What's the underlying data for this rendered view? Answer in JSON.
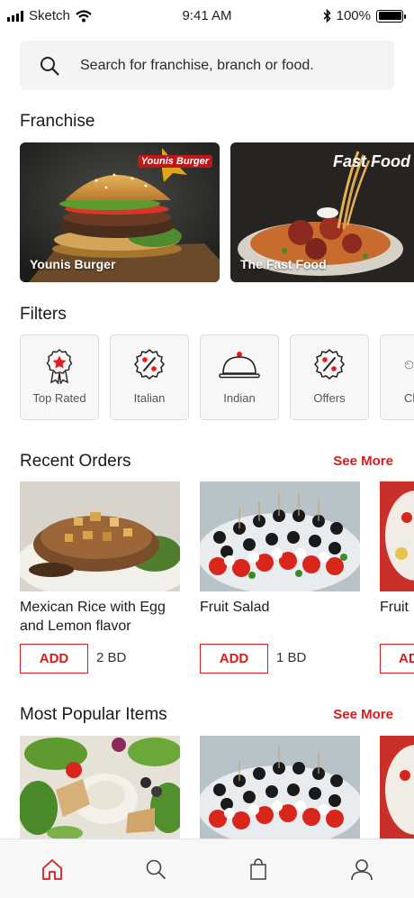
{
  "status_bar": {
    "carrier": "Sketch",
    "time": "9:41 AM",
    "battery": "100%",
    "battery_level": 1.0
  },
  "search": {
    "placeholder": "Search for franchise, branch or food."
  },
  "franchise": {
    "title": "Franchise",
    "items": [
      {
        "label": "Younis Burger",
        "logo_text": "Younis Burger"
      },
      {
        "label": "The Fast Food",
        "logo_text": "Fast Food"
      }
    ]
  },
  "filters": {
    "title": "Filters",
    "items": [
      {
        "label": "Top Rated",
        "icon": "award-star-icon"
      },
      {
        "label": "Italian",
        "icon": "percent-badge-icon"
      },
      {
        "label": "Indian",
        "icon": "cloche-icon"
      },
      {
        "label": "Offers",
        "icon": "percent-badge-icon"
      },
      {
        "label": "Ch",
        "icon": "percent-badge-icon"
      }
    ]
  },
  "recent_orders": {
    "title": "Recent Orders",
    "see_more": "See More",
    "items": [
      {
        "name": "Mexican Rice with Egg and Lemon flavor",
        "add": "ADD",
        "price": "2 BD"
      },
      {
        "name": "Fruit Salad",
        "add": "ADD",
        "price": "1 BD"
      },
      {
        "name": "Fruit",
        "add": "AD",
        "price": ""
      }
    ]
  },
  "popular": {
    "title": "Most Popular Items",
    "see_more": "See More"
  },
  "tabbar": {
    "items": [
      "home-icon",
      "search-icon",
      "bag-icon",
      "profile-icon"
    ]
  },
  "colors": {
    "accent": "#d61c1c",
    "background": "#ffffff",
    "search_bg": "#f4f4f4"
  }
}
